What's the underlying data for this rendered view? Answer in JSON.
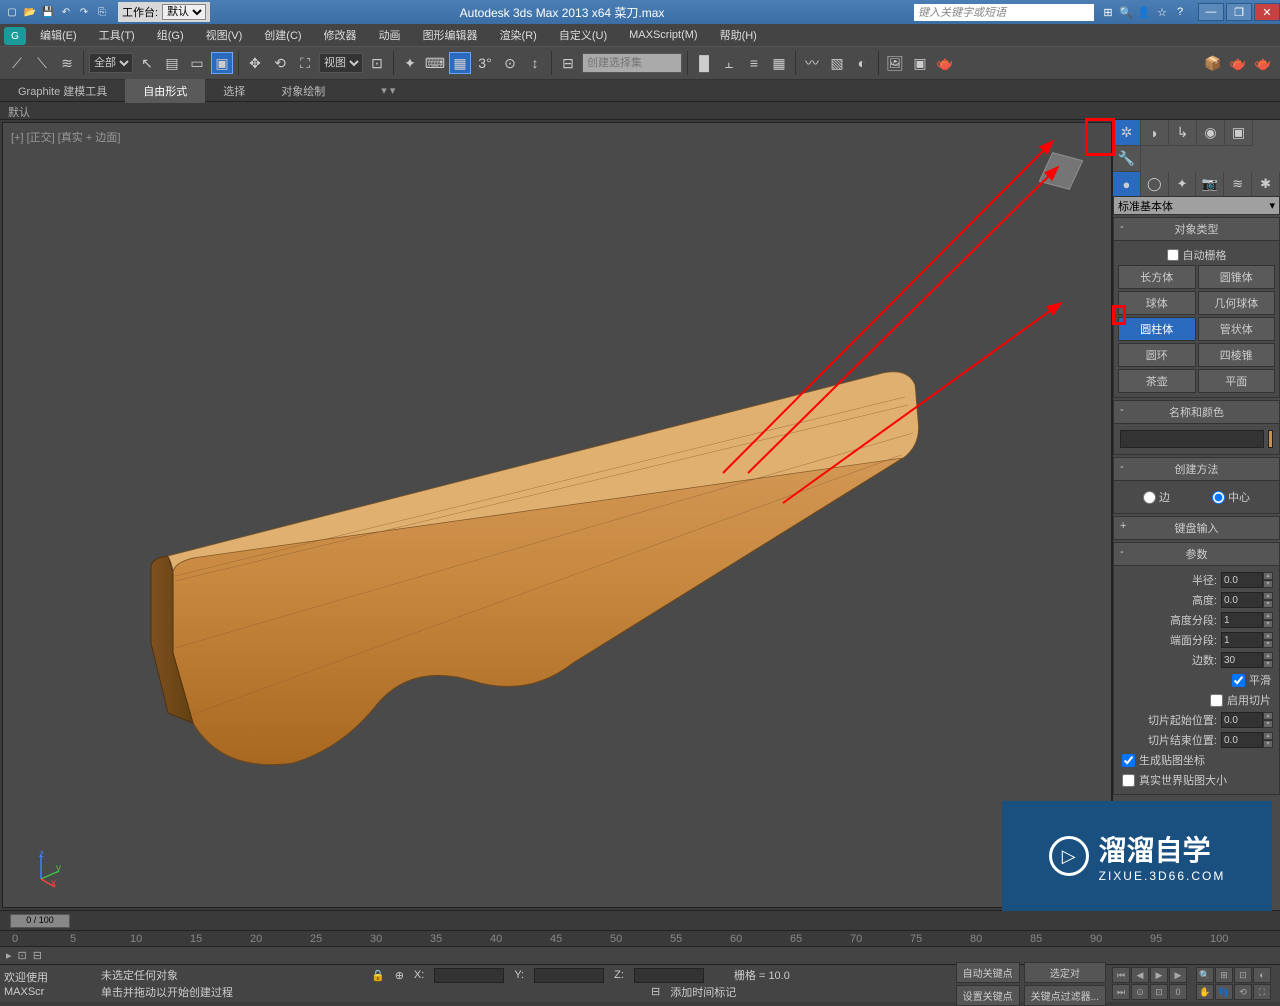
{
  "title": "Autodesk 3ds Max  2013 x64     菜刀.max",
  "workspace": {
    "label": "工作台:",
    "value": "默认"
  },
  "search_placeholder": "键入关键字或短语",
  "menu": [
    "编辑(E)",
    "工具(T)",
    "组(G)",
    "视图(V)",
    "创建(C)",
    "修改器",
    "动画",
    "图形编辑器",
    "渲染(R)",
    "自定义(U)",
    "MAXScript(M)",
    "帮助(H)"
  ],
  "filter_dd": "全部",
  "refcoord_dd": "视图",
  "selset_placeholder": "创建选择集",
  "ribbon": {
    "tabs": [
      "Graphite 建模工具",
      "自由形式",
      "选择",
      "对象绘制"
    ],
    "active": 1,
    "sub": "默认"
  },
  "viewport_label": "[+] [正交] [真实 + 边面]",
  "cp": {
    "dropdown": "标准基本体",
    "objtype_h": "对象类型",
    "autogrid": "自动栅格",
    "prims": [
      "长方体",
      "圆锥体",
      "球体",
      "几何球体",
      "圆柱体",
      "管状体",
      "圆环",
      "四棱锥",
      "茶壶",
      "平面"
    ],
    "prim_active": 4,
    "nc_h": "名称和颜色",
    "cm_h": "创建方法",
    "cm_edge": "边",
    "cm_center": "中心",
    "ki_h": "键盘输入",
    "params_h": "参数",
    "p": {
      "radius": "半径:",
      "radius_v": "0.0",
      "height": "高度:",
      "height_v": "0.0",
      "hseg": "高度分段:",
      "hseg_v": "1",
      "cseg": "端面分段:",
      "cseg_v": "1",
      "sides": "边数:",
      "sides_v": "30",
      "smooth": "平滑",
      "sliceon": "启用切片",
      "slicefrom": "切片起始位置:",
      "slicefrom_v": "0.0",
      "sliceto": "切片结束位置:",
      "sliceto_v": "0.0",
      "genmap": "生成贴图坐标",
      "realws": "真实世界贴图大小"
    }
  },
  "timeslider": "0 / 100",
  "status": {
    "welcome": "欢迎使用",
    "script": "MAXScr",
    "nosel": "未选定任何对象",
    "drag": "单击并拖动以开始创建过程",
    "x": "X:",
    "y": "Y:",
    "z": "Z:",
    "grid": "栅格 = 10.0",
    "addtime": "添加时间标记",
    "autokey": "自动关键点",
    "setkey": "设置关键点",
    "selset": "选定对",
    "keyfilt": "关键点过滤器..."
  },
  "watermark": {
    "t1": "溜溜自学",
    "t2": "ZIXUE.3D66.COM"
  }
}
